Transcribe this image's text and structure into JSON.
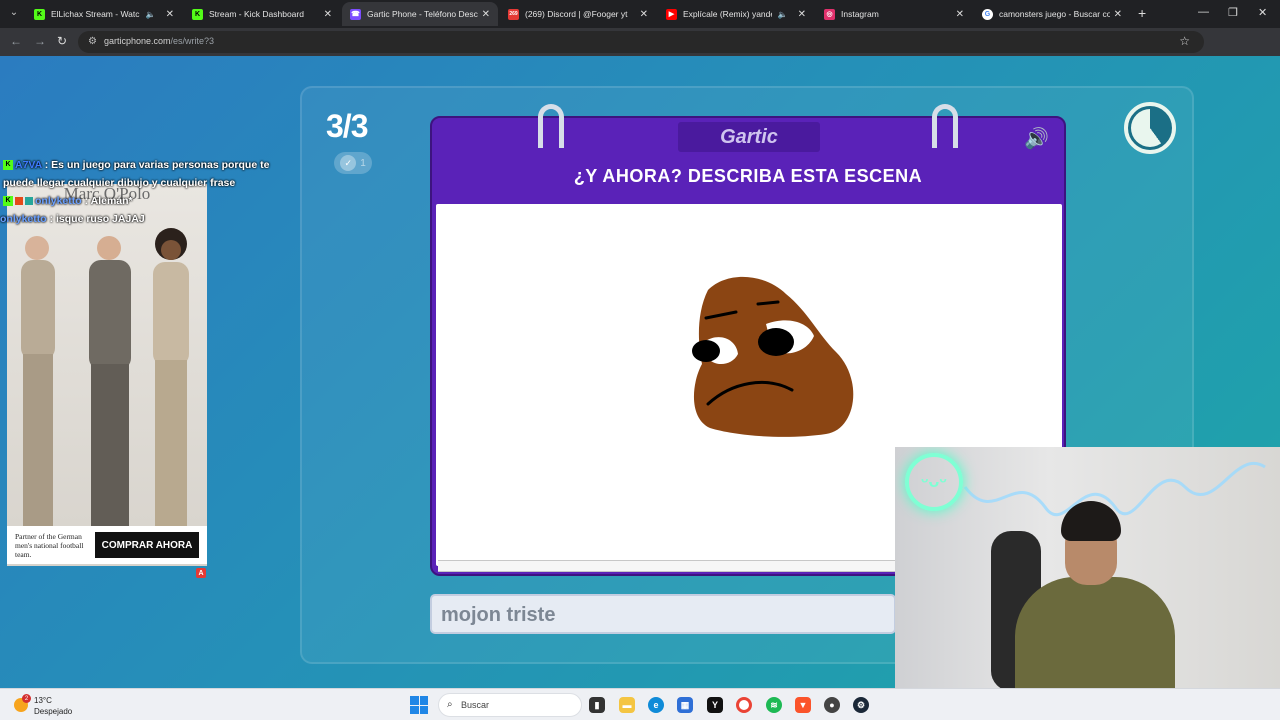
{
  "tabs": [
    {
      "title": "ElLichax Stream - Watch Liv",
      "favicon_color": "#53fc18",
      "favicon_glyph": "K",
      "audio": true
    },
    {
      "title": "Stream - Kick Dashboard",
      "favicon_color": "#53fc18",
      "favicon_glyph": "K",
      "audio": false
    },
    {
      "title": "Gartic Phone - Teléfono Descon",
      "favicon_color": "#7c4dff",
      "favicon_glyph": "☎",
      "audio": false,
      "active": true
    },
    {
      "title": "(269) Discord | @Fooger yt",
      "favicon_color": "#5865f2",
      "favicon_glyph": "269",
      "audio": false
    },
    {
      "title": "Explícale (Remix) yandel, nc",
      "favicon_color": "#ff0000",
      "favicon_glyph": "▶",
      "audio": true
    },
    {
      "title": "Instagram",
      "favicon_color": "#e1306c",
      "favicon_glyph": "◎",
      "audio": false
    },
    {
      "title": "camonsters juego - Buscar con",
      "favicon_color": "#4285f4",
      "favicon_glyph": "G",
      "audio": false
    }
  ],
  "address": {
    "host": "garticphone.com",
    "path": "/es/write?3"
  },
  "game": {
    "round": "3/3",
    "round_check": "1",
    "logo": "Gartic",
    "prompt": "¿Y AHORA? DESCRIBA ESTA ESCENA",
    "answer": "mojon triste"
  },
  "chat": [
    {
      "user": "A7VA",
      "message": ": Es un juego para varias personas porque te",
      "user_color": "#3d7bff"
    },
    {
      "user": "",
      "message": "puede llegar cualquier dibujo y cualquier frase",
      "user_color": ""
    },
    {
      "user": "onlyketto",
      "message": ": Alemán*",
      "user_color": "#6aa0ff"
    },
    {
      "user": "onlyketto",
      "message": ": isque ruso JAJAJ",
      "user_color": "#6aa0ff"
    }
  ],
  "ad": {
    "brand": "Marc O'Polo",
    "partner": "Partner of the German men's national football team.",
    "cta": "COMPRAR AHORA",
    "badge": "A"
  },
  "taskbar": {
    "temperature": "13°C",
    "weather": "Despejado",
    "notification_count": "2",
    "search_placeholder": "Buscar"
  }
}
